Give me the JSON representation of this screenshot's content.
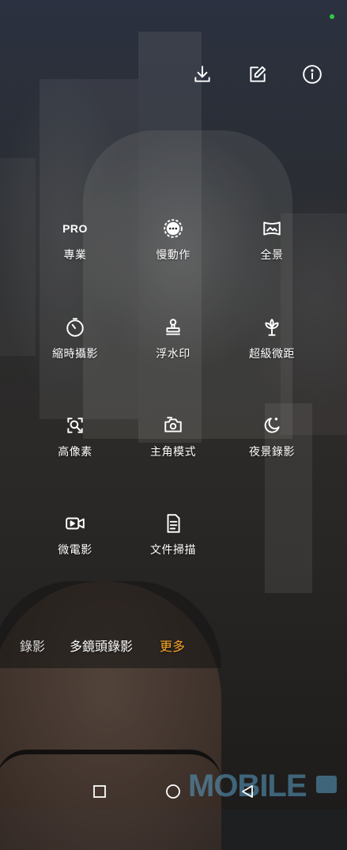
{
  "colors": {
    "accent": "#f5a623",
    "status_dot": "#2ecc40",
    "icon": "#ffffff"
  },
  "top_actions": [
    {
      "name": "download",
      "icon": "download-icon"
    },
    {
      "name": "edit",
      "icon": "edit-icon"
    },
    {
      "name": "info",
      "icon": "info-icon"
    }
  ],
  "modes": {
    "pro": {
      "icon_text": "PRO",
      "label": "專業"
    },
    "slow_motion": {
      "icon": "slow-motion-icon",
      "label": "慢動作"
    },
    "panorama": {
      "icon": "panorama-icon",
      "label": "全景"
    },
    "time_lapse": {
      "icon": "timer-icon",
      "label": "縮時攝影"
    },
    "watermark": {
      "icon": "stamp-icon",
      "label": "浮水印"
    },
    "super_macro": {
      "icon": "flower-icon",
      "label": "超級微距"
    },
    "high_res": {
      "icon": "high-res-icon",
      "label": "高像素"
    },
    "protagonist": {
      "icon": "protagonist-icon",
      "label": "主角模式"
    },
    "night_video": {
      "icon": "moon-icon",
      "label": "夜景錄影"
    },
    "micro_movie": {
      "icon": "video-camera-icon",
      "label": "微電影"
    },
    "doc_scan": {
      "icon": "document-icon",
      "label": "文件掃描"
    }
  },
  "bottom_modes": {
    "video": "錄影",
    "multi_lens_video": "多鏡頭錄影",
    "more": "更多"
  },
  "watermark_text": "MOBILE"
}
